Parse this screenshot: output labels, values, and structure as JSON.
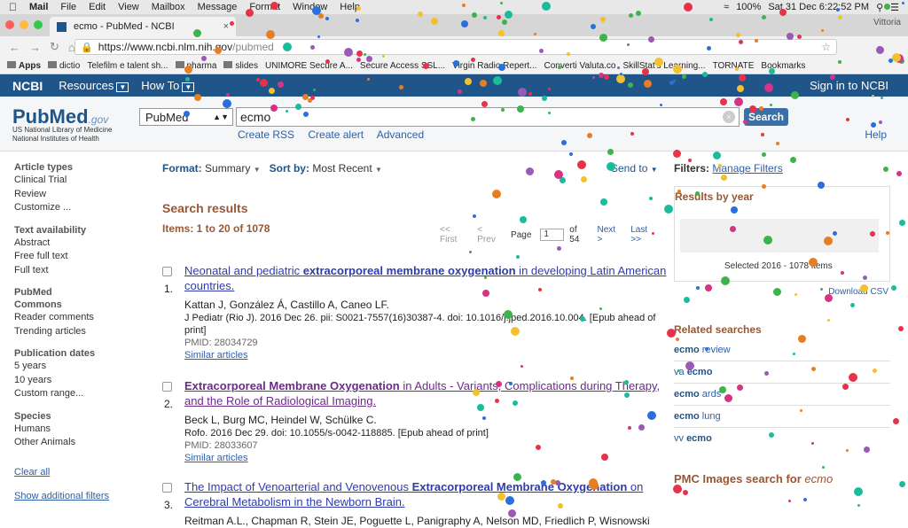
{
  "menubar": {
    "app": "Mail",
    "items": [
      "File",
      "Edit",
      "View",
      "Mailbox",
      "Message",
      "Format",
      "Window",
      "Help"
    ],
    "battery": "100%",
    "clock": "Sat 31 Dec  6:22:52 PM"
  },
  "browser": {
    "tab_title": "ecmo - PubMed - NCBI",
    "profile": "Vittoria",
    "url_host": "https://www.ncbi.nlm.nih.gov",
    "url_path": "/pubmed",
    "bookmarks": [
      "Apps",
      "dictio",
      "Telefilm e talent sh...",
      "pharma",
      "slides",
      "UNIMORE Secure A...",
      "Secure Access SSL...",
      "Virgin Radio Repert...",
      "Converti Valuta.co",
      "SkillStat's Learning...",
      "TORNATE",
      "Bookmarks"
    ]
  },
  "ncbi": {
    "logo": "NCBI",
    "resources": "Resources",
    "howto": "How To",
    "signin": "Sign in to NCBI"
  },
  "search": {
    "logo_pub": "PubMed",
    "logo_gov": ".gov",
    "sub1": "US National Library of Medicine",
    "sub2": "National Institutes of Health",
    "db": "PubMed",
    "query": "ecmo",
    "button": "Search",
    "links": [
      "Create RSS",
      "Create alert",
      "Advanced"
    ],
    "help": "Help"
  },
  "sidebar": {
    "sections": [
      {
        "title": "Article types",
        "items": [
          "Clinical Trial",
          "Review",
          "Customize ..."
        ]
      },
      {
        "title": "Text availability",
        "items": [
          "Abstract",
          "Free full text",
          "Full text"
        ]
      },
      {
        "title": "PubMed Commons",
        "items": [
          "Reader comments",
          "Trending articles"
        ]
      },
      {
        "title": "Publication dates",
        "items": [
          "5 years",
          "10 years",
          "Custom range..."
        ]
      },
      {
        "title": "Species",
        "items": [
          "Humans",
          "Other Animals"
        ]
      }
    ],
    "clear_all": "Clear all",
    "show_filters": "Show additional filters"
  },
  "results": {
    "format_label": "Format:",
    "format_value": "Summary",
    "sort_label": "Sort by:",
    "sort_value": "Most Recent",
    "send_to": "Send to",
    "heading": "Search results",
    "items": "Items: 1 to 20 of 1078",
    "pager": {
      "first": "<< First",
      "prev": "< Prev",
      "page_label": "Page",
      "page": "1",
      "of": "of 54",
      "next": "Next >",
      "last": "Last >>"
    },
    "list": [
      {
        "n": "1.",
        "t1": "Neonatal and pediatric ",
        "t2": "extracorporeal membrane oxygenation",
        "t3": " in developing Latin American countries.",
        "authors": "Kattan J, González Á, Castillo A, Caneo LF.",
        "cite": "J Pediatr (Rio J). 2016 Dec 26. pii: S0021-7557(16)30387-4. doi: 10.1016/j.jped.2016.10.004. [Epub ahead of print]",
        "pmid": "PMID: 28034729",
        "similar": "Similar articles"
      },
      {
        "n": "2.",
        "t1": "",
        "t2": "Extracorporeal Membrane Oxygenation",
        "t3": " in Adults - Variants, Complications during Therapy, and the Role of Radiological Imaging.",
        "authors": "Beck L, Burg MC, Heindel W, Schülke C.",
        "cite": "Rofo. 2016 Dec 29. doi: 10.1055/s-0042-118885. [Epub ahead of print]",
        "pmid": "PMID: 28033607",
        "similar": "Similar articles"
      },
      {
        "n": "3.",
        "t1": "The Impact of Venoarterial and Venovenous ",
        "t2": "Extracorporeal Membrane Oxygenation",
        "t3": " on Cerebral Metabolism in the Newborn Brain.",
        "authors": "Reitman A.L., Chapman R, Stein JE, Poguette L, Panigraphy A, Nelson MD, Friedlich P, Wisnowski"
      }
    ]
  },
  "right": {
    "filters_label": "Filters:",
    "manage": "Manage Filters",
    "years_heading": "Results by year",
    "selected": "Selected 2016 - 1078 items",
    "download": "Download CSV",
    "related_heading": "Related searches",
    "related": [
      {
        "pre": "",
        "b": "ecmo",
        "post": " review"
      },
      {
        "pre": "va ",
        "b": "ecmo",
        "post": ""
      },
      {
        "pre": "",
        "b": "ecmo",
        "post": " ards"
      },
      {
        "pre": "",
        "b": "ecmo",
        "post": " lung"
      },
      {
        "pre": "vv ",
        "b": "ecmo",
        "post": ""
      }
    ],
    "pmc_heading": "PMC Images search for ",
    "pmc_term": "ecmo"
  }
}
